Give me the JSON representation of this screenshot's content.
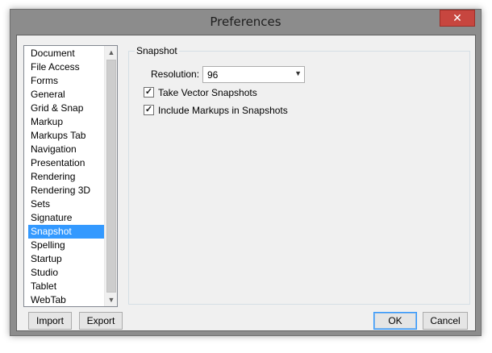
{
  "window": {
    "title": "Preferences",
    "close_label": "✕"
  },
  "categories": {
    "items": [
      {
        "label": "Document"
      },
      {
        "label": "File Access"
      },
      {
        "label": "Forms"
      },
      {
        "label": "General"
      },
      {
        "label": "Grid & Snap"
      },
      {
        "label": "Markup"
      },
      {
        "label": "Markups Tab"
      },
      {
        "label": "Navigation"
      },
      {
        "label": "Presentation"
      },
      {
        "label": "Rendering"
      },
      {
        "label": "Rendering 3D"
      },
      {
        "label": "Sets"
      },
      {
        "label": "Signature"
      },
      {
        "label": "Snapshot",
        "selected": true
      },
      {
        "label": "Spelling"
      },
      {
        "label": "Startup"
      },
      {
        "label": "Studio"
      },
      {
        "label": "Tablet"
      },
      {
        "label": "WebTab"
      }
    ],
    "scroll_up_icon": "▲",
    "scroll_down_icon": "▼"
  },
  "snapshot": {
    "group_label": "Snapshot",
    "resolution_label": "Resolution:",
    "resolution_value": "96",
    "dropdown_icon": "▼",
    "take_vector_label": "Take Vector Snapshots",
    "take_vector_checked": "✓",
    "include_markups_label": "Include Markups in Snapshots",
    "include_markups_checked": "✓"
  },
  "buttons": {
    "import": "Import",
    "export": "Export",
    "ok": "OK",
    "cancel": "Cancel"
  }
}
